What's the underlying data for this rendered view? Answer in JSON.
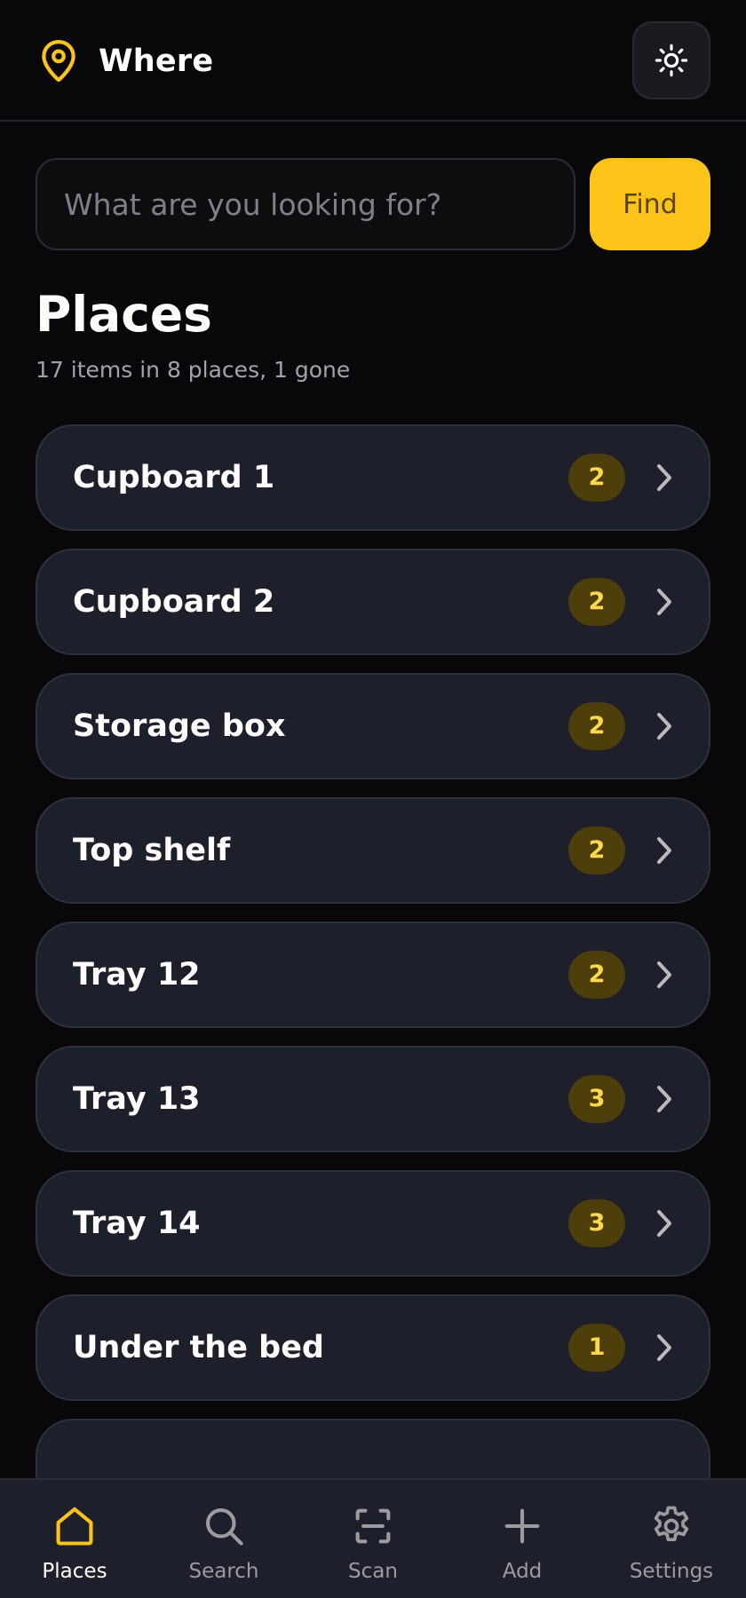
{
  "app": {
    "title": "Where",
    "accent_color": "#fcc419",
    "icons": {
      "brand": "map-pin-icon",
      "theme_toggle": "sun-icon"
    }
  },
  "search": {
    "placeholder": "What are you looking for?",
    "value": "",
    "button_label": "Find"
  },
  "section": {
    "title": "Places",
    "subtitle": "17 items in 8 places, 1 gone"
  },
  "places": [
    {
      "name": "Cupboard 1",
      "count": "2"
    },
    {
      "name": "Cupboard 2",
      "count": "2"
    },
    {
      "name": "Storage box",
      "count": "2"
    },
    {
      "name": "Top shelf",
      "count": "2"
    },
    {
      "name": "Tray 12",
      "count": "2"
    },
    {
      "name": "Tray 13",
      "count": "3"
    },
    {
      "name": "Tray 14",
      "count": "3"
    },
    {
      "name": "Under the bed",
      "count": "1"
    }
  ],
  "nav": {
    "items": [
      {
        "label": "Places",
        "icon": "home-icon",
        "active": true
      },
      {
        "label": "Search",
        "icon": "search-icon",
        "active": false
      },
      {
        "label": "Scan",
        "icon": "scan-icon",
        "active": false
      },
      {
        "label": "Add",
        "icon": "plus-icon",
        "active": false
      },
      {
        "label": "Settings",
        "icon": "gear-icon",
        "active": false
      }
    ]
  }
}
